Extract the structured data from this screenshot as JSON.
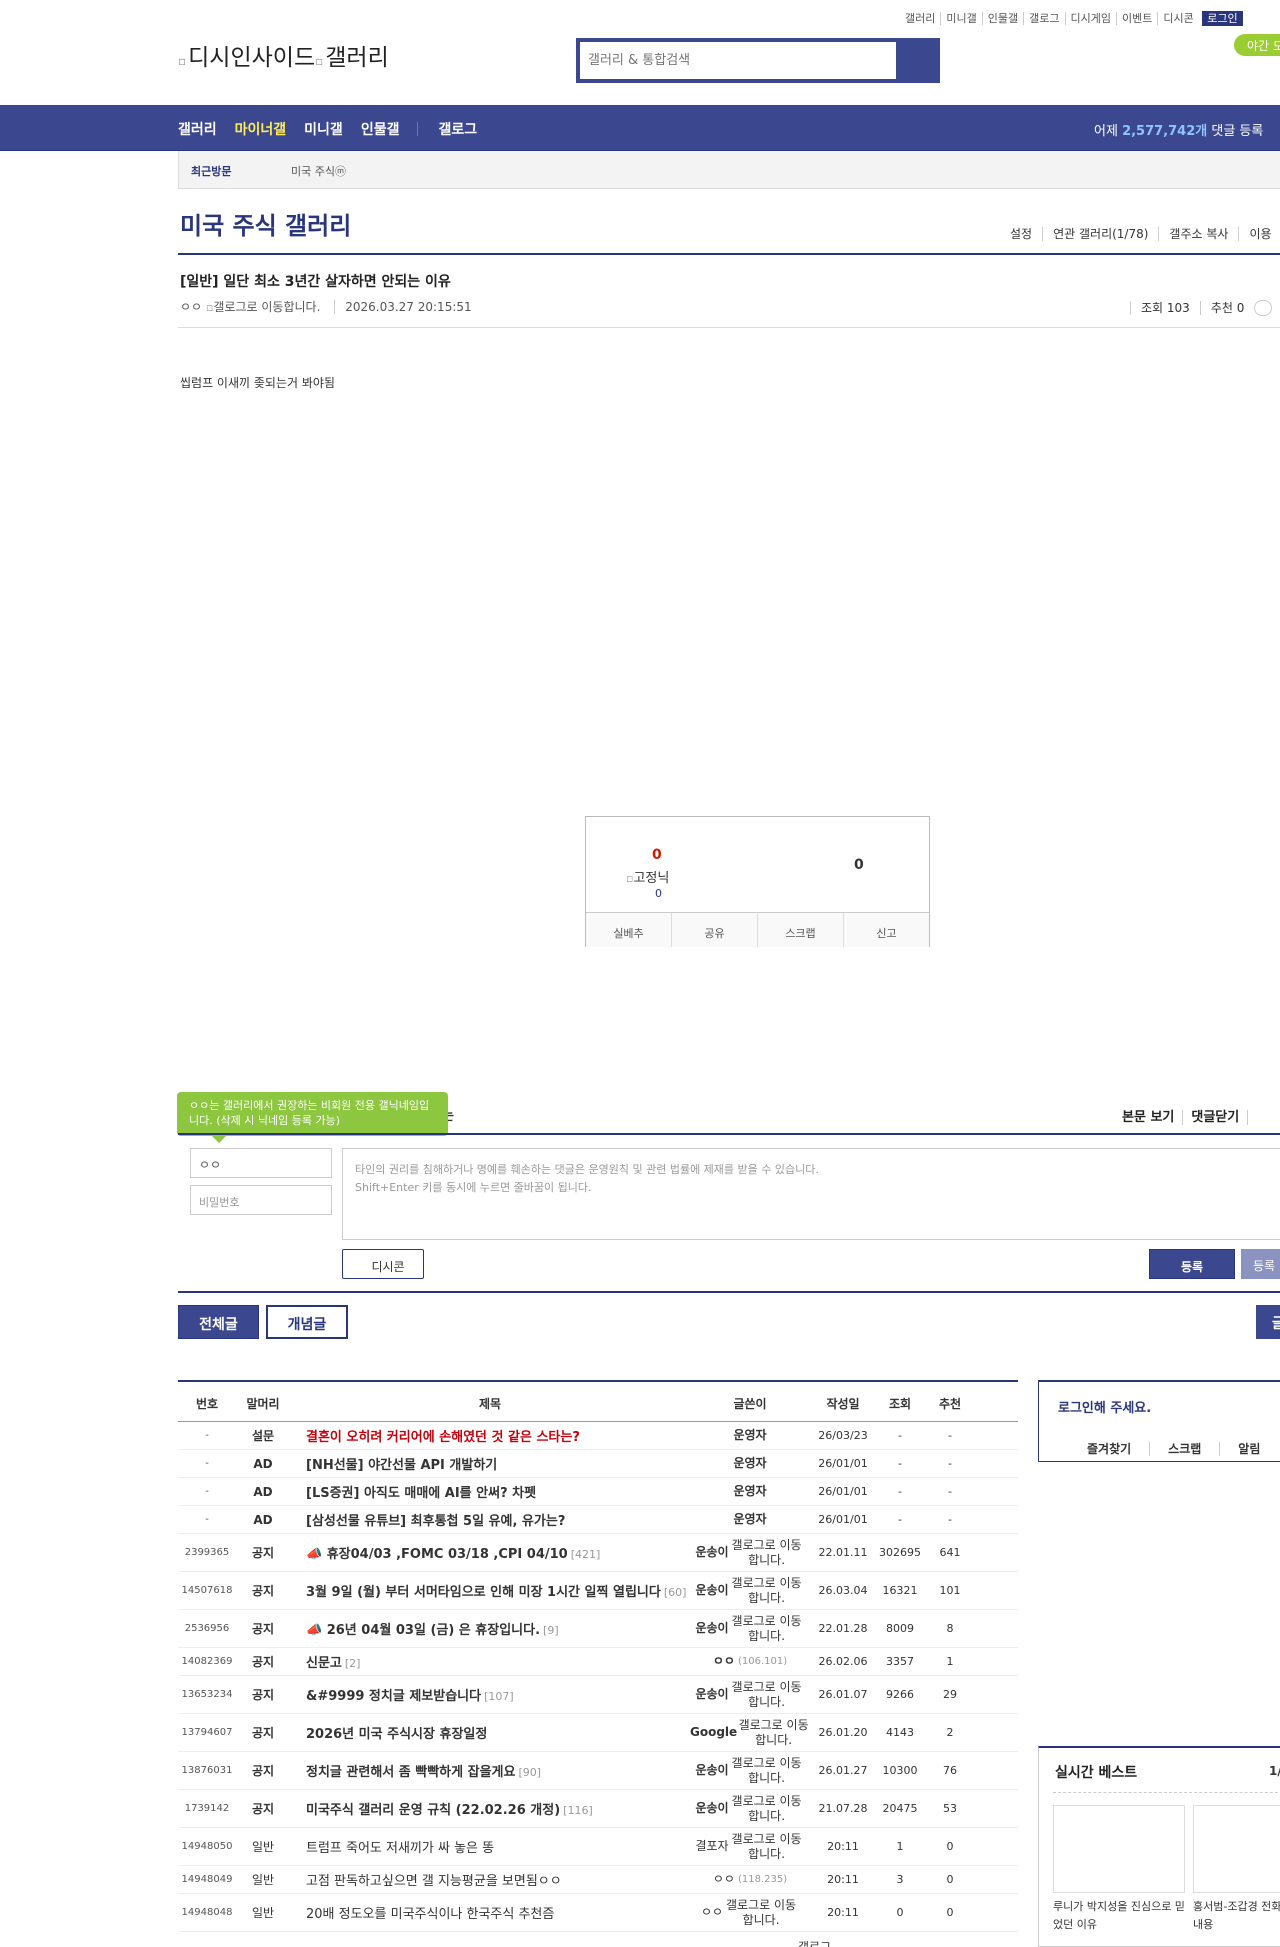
{
  "top_util": {
    "links": [
      "갤러리",
      "미니갤",
      "인물갤",
      "갤로그",
      "디시게임",
      "이벤트",
      "디시콘"
    ],
    "login": "로그인",
    "night_mode": "야간 모드"
  },
  "header": {
    "logo_alt": "디시인사이드",
    "logo_gallery_alt": "갤러리",
    "search_placeholder": "갤러리 & 통합검색"
  },
  "gnb": {
    "menu": [
      "갤러리",
      "마이너갤",
      "미니갤",
      "인물갤"
    ],
    "active_menu": "마이너갤",
    "gallog": "갤로그",
    "count_prefix": "어제",
    "count_value": "2,577,742개",
    "count_suffix": "댓글 등록"
  },
  "recent_visit": {
    "label": "최근방문",
    "item": "미국 주식ⓜ"
  },
  "gallery": {
    "title": "미국 주식 갤러리",
    "links": [
      "설정",
      "연관 갤러리(1/78)",
      "갤주소 복사",
      "이용"
    ]
  },
  "post": {
    "title": "[일반] 일단 최소 3년간 살자하면 안되는 이유",
    "author": "ㅇㅇ",
    "gallog_alt": "갤로그로 이동합니다.",
    "date": "2026.03.27 20:15:51",
    "views": "조회 103",
    "recommend": "추천 0",
    "body": "씹럼프 이새끼 좆되는거 봐야됨"
  },
  "recommend_box": {
    "up_count": "0",
    "nick_alt": "고정닉",
    "fixed_count": "0",
    "down_count": "0",
    "buttons": [
      "실베추",
      "공유",
      "스크랩",
      "신고"
    ]
  },
  "comment": {
    "tooltip": "ㅇㅇ는 갤러리에서 권장하는 비회원 전용 갤닉네임입니다. (삭제 시 닉네임 등록 가능)",
    "heading_fragment": "는",
    "view_post": "본문 보기",
    "close_comments": "댓글닫기",
    "nickname": "ㅇㅇ",
    "password_placeholder": "비밀번호",
    "textarea_line1": "타인의 권리를 침해하거나 명예를 훼손하는 댓글은 운영원칙 및 관련 법률에 제재를 받을 수 있습니다.",
    "textarea_line2": "Shift+Enter 키를 동시에 누르면 줄바꿈이 됩니다.",
    "dccon": "디시콘",
    "register": "등록",
    "register2": "등록"
  },
  "tabs": {
    "all": "전체글",
    "concept": "개념글",
    "right": "글"
  },
  "list": {
    "headers": [
      "번호",
      "말머리",
      "제목",
      "글쓴이",
      "작성일",
      "조회",
      "추천"
    ],
    "rows": [
      {
        "no": "-",
        "sub": "설문",
        "title": "결혼이 오히려 커리어에 손해였던 것 같은 스타는?",
        "replies": "",
        "writer": "운영자",
        "date": "26/03/23",
        "views": "-",
        "rec": "-"
      },
      {
        "no": "-",
        "sub": "AD",
        "title": "[NH선물] 야간선물 API 개발하기",
        "replies": "",
        "writer": "운영자",
        "date": "26/01/01",
        "views": "-",
        "rec": "-"
      },
      {
        "no": "-",
        "sub": "AD",
        "title": "[LS증권] 아직도 매매에 AI를 안써? 차펫",
        "replies": "",
        "writer": "운영자",
        "date": "26/01/01",
        "views": "-",
        "rec": "-"
      },
      {
        "no": "-",
        "sub": "AD",
        "title": "[삼성선물 유튜브] 최후통첩 5일 유예, 유가는?",
        "replies": "",
        "writer": "운영자",
        "date": "26/01/01",
        "views": "-",
        "rec": "-"
      },
      {
        "no": "2399365",
        "sub": "공지",
        "title": "📣 휴장04/03 ,FOMC 03/18 ,CPI 04/10",
        "replies": "[421]",
        "writer": "운송이",
        "gallog": "갤로그로 이동합니다.",
        "date": "22.01.11",
        "views": "302695",
        "rec": "641"
      },
      {
        "no": "14507618",
        "sub": "공지",
        "title": "3월 9일 (월) 부터 서머타임으로 인해 미장 1시간 일찍 열립니다",
        "replies": "[60]",
        "writer": "운송이",
        "gallog": "갤로그로 이동합니다.",
        "date": "26.03.04",
        "views": "16321",
        "rec": "101"
      },
      {
        "no": "2536956",
        "sub": "공지",
        "title": "📣 26년 04월 03일 (금) 은 휴장입니다.",
        "replies": "[9]",
        "writer": "운송이",
        "gallog": "갤로그로 이동합니다.",
        "date": "22.01.28",
        "views": "8009",
        "rec": "8"
      },
      {
        "no": "14082369",
        "sub": "공지",
        "title": "신문고",
        "replies": "[2]",
        "writer": "ㅇㅇ",
        "ip": "(106.101)",
        "date": "26.02.06",
        "views": "3357",
        "rec": "1"
      },
      {
        "no": "13653234",
        "sub": "공지",
        "title": "&#9999 정치글 제보받습니다",
        "replies": "[107]",
        "writer": "운송이",
        "gallog": "갤로그로 이동합니다.",
        "date": "26.01.07",
        "views": "9266",
        "rec": "29"
      },
      {
        "no": "13794607",
        "sub": "공지",
        "title": "2026년 미국 주식시장 휴장일정",
        "replies": "",
        "writer": "Google",
        "gallog": "갤로그로 이동합니다.",
        "date": "26.01.20",
        "views": "4143",
        "rec": "2"
      },
      {
        "no": "13876031",
        "sub": "공지",
        "title": "정치글 관련해서 좀 빡빡하게 잡을게요",
        "replies": "[90]",
        "writer": "운송이",
        "gallog": "갤로그로 이동합니다.",
        "date": "26.01.27",
        "views": "10300",
        "rec": "76"
      },
      {
        "no": "1739142",
        "sub": "공지",
        "title": "미국주식 갤러리 운영 규칙 (22.02.26 개정)",
        "replies": "[116]",
        "writer": "운송이",
        "gallog": "갤로그로 이동합니다.",
        "date": "21.07.28",
        "views": "20475",
        "rec": "53"
      },
      {
        "no": "14948050",
        "sub": "일반",
        "title": "트럼프 죽어도 저새끼가 싸 놓은 똥",
        "replies": "",
        "writer": "결포자",
        "gallog": "갤로그로 이동합니다.",
        "date": "20:11",
        "views": "1",
        "rec": "0"
      },
      {
        "no": "14948049",
        "sub": "일반",
        "title": "고점 판독하고싶으면 갤 지능평균을 보면됨ㅇㅇ",
        "replies": "",
        "writer": "ㅇㅇ",
        "ip": "(118.235)",
        "date": "20:11",
        "views": "3",
        "rec": "0"
      },
      {
        "no": "14948048",
        "sub": "일반",
        "title": "20배 정도오를 미국주식이나 한국주식 추천즘",
        "replies": "",
        "writer": "ㅇㅇ",
        "gallog": "갤로그로 이동합니다.",
        "date": "20:11",
        "views": "0",
        "rec": "0"
      }
    ],
    "partial_last": "갤로그"
  },
  "sidebar": {
    "login_prompt": "로그인해 주세요.",
    "login_links": [
      "즐겨찾기",
      "스크랩",
      "알림"
    ],
    "best_title": "실시간 베스트",
    "best_page": "1/",
    "best_items": [
      {
        "caption": "루니가 박지성을 진심으로 믿었던 이유"
      },
      {
        "caption": "홍서범-조갑경 전화 인터뷰 내용"
      }
    ]
  }
}
